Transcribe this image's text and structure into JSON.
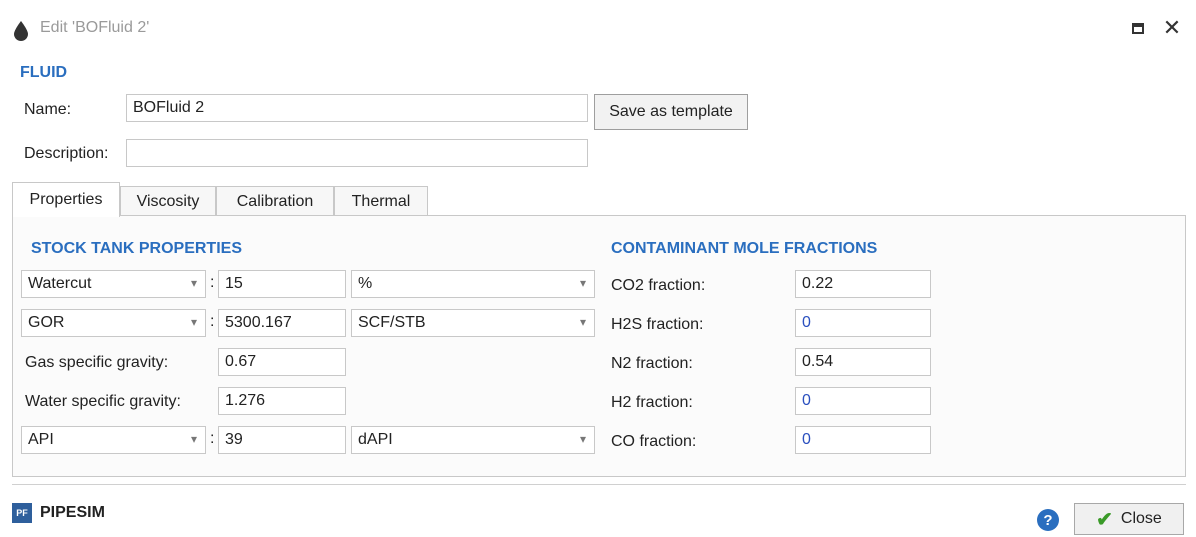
{
  "window": {
    "title": "Edit 'BOFluid 2'",
    "maximize_glyph": "☐",
    "close_glyph": "✕",
    "icon": "drop-icon"
  },
  "fluid": {
    "section_title": "FLUID",
    "name_label": "Name:",
    "name_value": "BOFluid 2",
    "save_template_label": "Save as template",
    "description_label": "Description:",
    "description_value": ""
  },
  "tabs": [
    {
      "label": "Properties",
      "active": true
    },
    {
      "label": "Viscosity",
      "active": false
    },
    {
      "label": "Calibration",
      "active": false
    },
    {
      "label": "Thermal",
      "active": false
    }
  ],
  "stock_tank": {
    "section_title": "STOCK TANK PROPERTIES",
    "watercut": {
      "selector": "Watercut",
      "value": "15",
      "unit": "%"
    },
    "gor": {
      "selector": "GOR",
      "value": "5300.167",
      "unit": "SCF/STB"
    },
    "gas_sg": {
      "label": "Gas specific gravity:",
      "value": "0.67"
    },
    "water_sg": {
      "label": "Water specific gravity:",
      "value": "1.276"
    },
    "api": {
      "selector": "API",
      "value": "39",
      "unit": "dAPI"
    },
    "colon": ":"
  },
  "contaminants": {
    "section_title": "CONTAMINANT MOLE FRACTIONS",
    "rows": [
      {
        "label": "CO2 fraction:",
        "value": "0.22"
      },
      {
        "label": "H2S fraction:",
        "value": "0"
      },
      {
        "label": "N2 fraction:",
        "value": "0.54"
      },
      {
        "label": "H2 fraction:",
        "value": "0"
      },
      {
        "label": "CO fraction:",
        "value": "0"
      }
    ]
  },
  "footer": {
    "brand_logo": "PF",
    "brand": "PIPESIM",
    "help_glyph": "?",
    "close_label": "Close",
    "check_glyph": "✔"
  },
  "colors": {
    "accent": "#2a6ebf",
    "check": "#3a9a28"
  }
}
